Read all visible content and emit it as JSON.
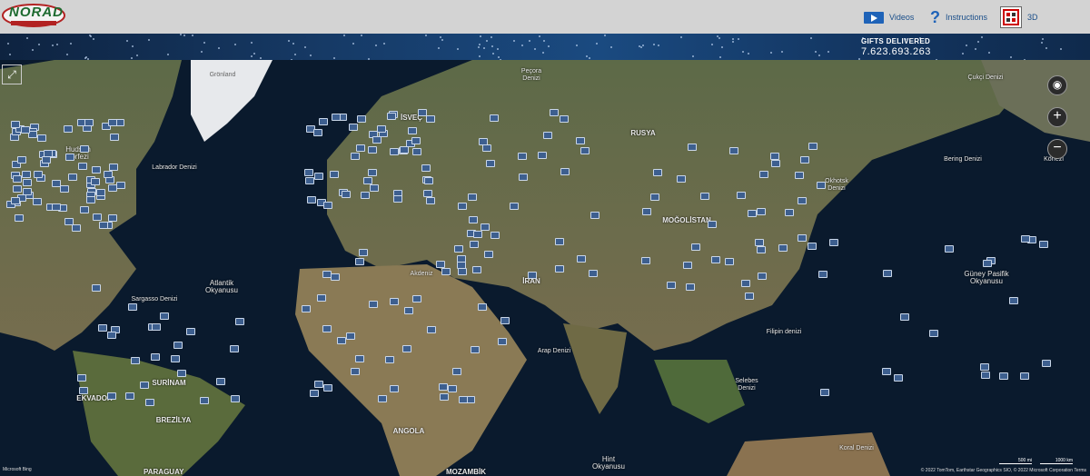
{
  "header": {
    "logo_text": "NORAD",
    "nav": [
      {
        "label": "Videos",
        "icon": "video-icon"
      },
      {
        "label": "Instructions",
        "icon": "help-icon"
      },
      {
        "label": "3D",
        "icon": "3d-icon"
      }
    ]
  },
  "tracker": {
    "gifts_label": "GIFTS DELIVERED",
    "gifts_value": "7.623.693.263"
  },
  "map": {
    "labels": {
      "hudson": "Hudson körfezi",
      "labrador": "Labrador Denizi",
      "atlantik": "Atlantik Okyanusu",
      "sargasso": "Sargasso Denizi",
      "greenland": "Grönland",
      "pegora": "Peçora Denizi",
      "isvec": "İSVEÇ",
      "rusya": "RUSYA",
      "mogolistan": "MOĞOLİSTAN",
      "okhotsk": "Okhotsk Denizi",
      "bering": "Bering Denizi",
      "cukgi": "Çukçi Denizi",
      "akdeniz": "Akdeniz",
      "iran": "İRAN",
      "arap": "Arap Denizi",
      "filipin": "Filipin denizi",
      "guney": "Güney Pasifik Okyanusu",
      "selebes": "Selebes Denizi",
      "koral": "Koral Denizi",
      "hint": "Hint Okyanusu",
      "ekvador": "EKVADOR",
      "surinam": "SURİNAM",
      "brezilya": "BREZİLYA",
      "angola": "ANGOLA",
      "mozambik": "MOZAMBİK",
      "paraguay": "PARAGUAY",
      "kortez": "Körfezi"
    },
    "scale": {
      "mi": "500 mi",
      "km": "1000 km"
    },
    "brand": "Microsoft Bing",
    "credits": "© 2022 TomTom, Earthstar Geographics SIO, © 2022 Microsoft Corporation  Terms",
    "colors": {
      "marker": "#3d5f8f",
      "ocean": "#0a1a2d",
      "land": "#5f6b45"
    }
  }
}
